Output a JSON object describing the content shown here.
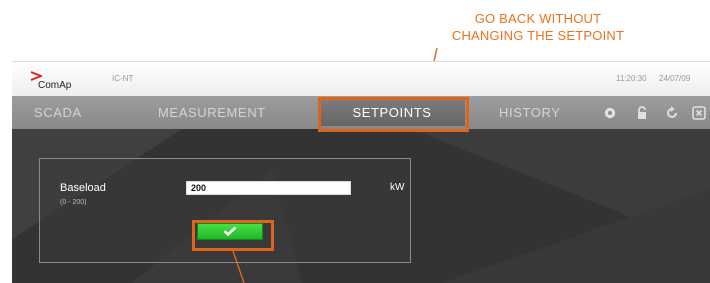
{
  "annotation": {
    "line1": "GO BACK WITHOUT",
    "line2": "CHANGING THE SETPOINT"
  },
  "header": {
    "brand": "ComAp",
    "model": "IC-NT",
    "time": "11:20:30",
    "date": "24/07/09"
  },
  "tabs": [
    {
      "label": "SCADA"
    },
    {
      "label": "MEASUREMENT"
    },
    {
      "label": "SETPOINTS",
      "active": true
    },
    {
      "label": "HISTORY"
    }
  ],
  "nav_icons": [
    "gear-icon",
    "lock-icon",
    "refresh-icon",
    "close-icon"
  ],
  "setpoint": {
    "name": "Baseload",
    "range": "(0 - 200)",
    "value": "200",
    "unit": "kW",
    "confirm_icon": "checkmark-icon"
  },
  "colors": {
    "annotation": "#e8731f",
    "highlight": "#e0641a",
    "confirm": "#2fcc34",
    "logo": "#e2231a"
  }
}
